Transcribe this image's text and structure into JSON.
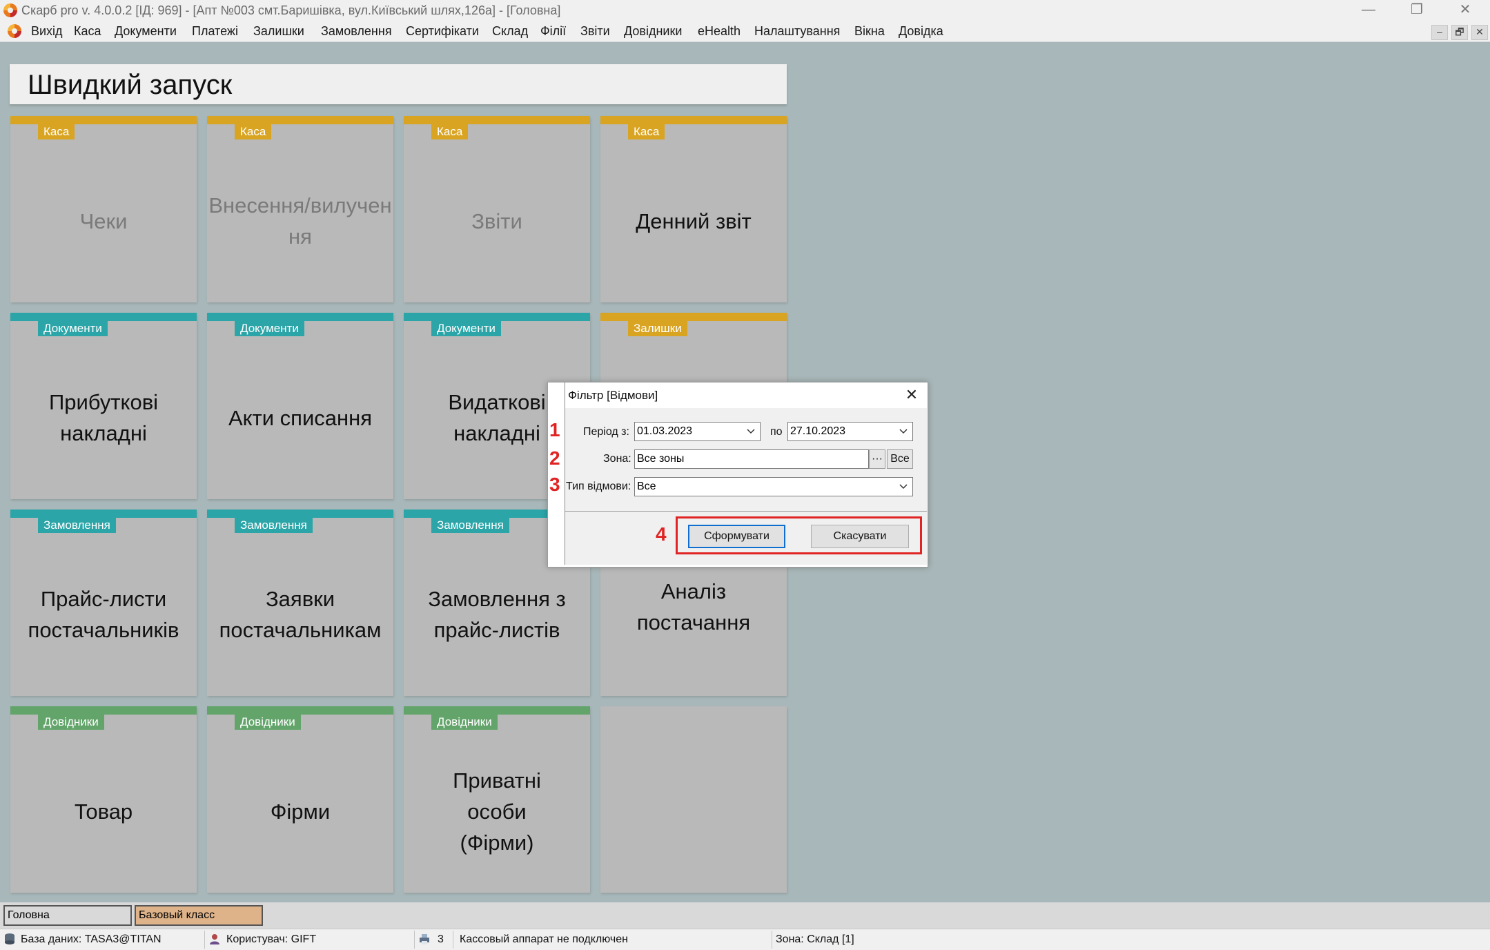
{
  "window": {
    "title": "Скарб pro v. 4.0.0.2 [ІД: 969] - [Апт №003 смт.Баришівка, вул.Київський шлях,126а] - [Головна]",
    "controls": {
      "minimize": "—",
      "restore": "❐",
      "close": "✕"
    }
  },
  "menu": {
    "items": [
      "Вихід",
      "Каса",
      "Документи",
      "Платежі",
      "Залишки",
      "Замовлення",
      "Сертифікати",
      "Склад",
      "Філії",
      "Звіти",
      "Довідники",
      "eHealth",
      "Налаштування",
      "Вікна",
      "Довідка"
    ],
    "mdi_controls": [
      "–",
      "🗗",
      "✕"
    ]
  },
  "quick_launch": {
    "title": "Швидкий запуск",
    "tiles": [
      {
        "tag": "Каса",
        "label": "Чеки",
        "dim": true,
        "color": "#d9a422"
      },
      {
        "tag": "Каса",
        "label": "Внесення/вилучення",
        "dim": true,
        "color": "#d9a422"
      },
      {
        "tag": "Каса",
        "label": "Звіти",
        "dim": true,
        "color": "#d9a422"
      },
      {
        "tag": "Каса",
        "label": "Денний звіт",
        "dim": false,
        "color": "#d9a422"
      },
      {
        "tag": "Документи",
        "label": "Прибуткові накладні",
        "dim": false,
        "color": "#2ca5a8"
      },
      {
        "tag": "Документи",
        "label": "Акти списання",
        "dim": false,
        "color": "#2ca5a8"
      },
      {
        "tag": "Документи",
        "label": "Видаткові накладні",
        "dim": false,
        "color": "#2ca5a8"
      },
      {
        "tag": "Залишки",
        "label": "",
        "dim": false,
        "color": "#d9a422"
      },
      {
        "tag": "Замовлення",
        "label": "Прайс-листи постачальників",
        "dim": false,
        "color": "#2ca5a8"
      },
      {
        "tag": "Замовлення",
        "label": "Заявки постачальникам",
        "dim": false,
        "color": "#2ca5a8"
      },
      {
        "tag": "Замовлення",
        "label": "Замовлення з прайс-листів",
        "dim": false,
        "color": "#2ca5a8"
      },
      {
        "tag": "",
        "label": "Аналіз постачання",
        "dim": false,
        "color": ""
      },
      {
        "tag": "Довідники",
        "label": "Товар",
        "dim": false,
        "color": "#62a46a"
      },
      {
        "tag": "Довідники",
        "label": "Фірми",
        "dim": false,
        "color": "#62a46a"
      },
      {
        "tag": "Довідники",
        "label": "Приватні особи (Фірми)",
        "dim": false,
        "color": "#62a46a"
      },
      {
        "tag": "",
        "label": "",
        "dim": false,
        "color": ""
      }
    ]
  },
  "dialog": {
    "title": "Фільтр [Відмови]",
    "close": "✕",
    "period_label": "Період з:",
    "period_from": "01.03.2023",
    "period_to_label": "по",
    "period_to": "27.10.2023",
    "zone_label": "Зона:",
    "zone_value": "Все зоны",
    "zone_browse": "···",
    "zone_all": "Все",
    "type_label": "Тип відмови:",
    "type_value": "Все",
    "submit": "Сформувати",
    "cancel": "Скасувати"
  },
  "annotations": [
    "1",
    "2",
    "3",
    "4"
  ],
  "tabs": [
    {
      "label": "Головна",
      "bg": "#d9d9d9"
    },
    {
      "label": "Базовый класс",
      "bg": "#deb38a"
    }
  ],
  "status": {
    "database": "База даних: TASA3@TITAN",
    "user": "Користувач: GIFT",
    "count": "3",
    "cash_register": "Кассовый аппарат не подключен",
    "zone": "Зона: Склад [1]"
  }
}
